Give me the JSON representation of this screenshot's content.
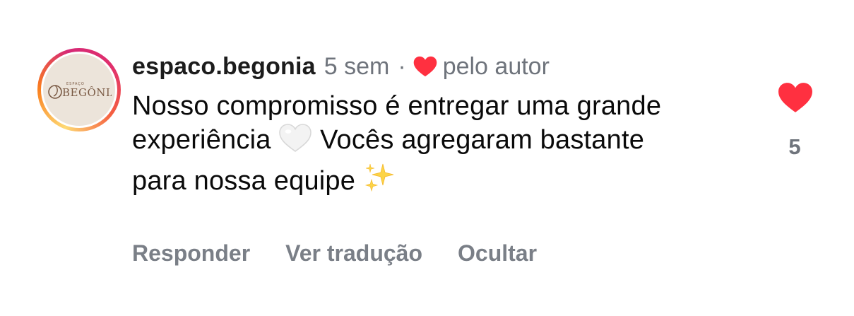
{
  "comment": {
    "username": "espaco.begonia",
    "timestamp": "5 sem",
    "separator": "·",
    "liked_by_label": "pelo autor",
    "avatar_logo_text": "ESPAÇO BEGÔNIA",
    "body": {
      "line1": "Nosso compromisso é entregar uma grande",
      "line2_before": "experiência",
      "line2_after": "Vocês agregaram bastante",
      "line3": "para nossa equipe"
    },
    "like_count": "5"
  },
  "actions": {
    "reply": "Responder",
    "translate": "Ver tradução",
    "hide": "Ocultar"
  },
  "colors": {
    "heart_red": "#ff3040",
    "muted_text": "#6f747c",
    "action_text": "#7a7f87"
  }
}
